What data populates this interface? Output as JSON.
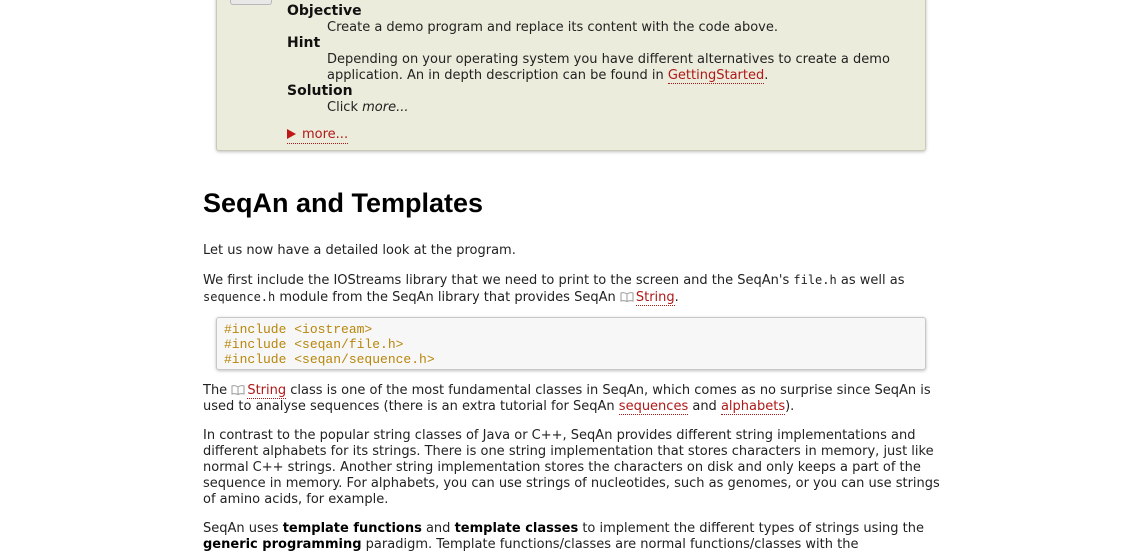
{
  "assignment": {
    "items": [
      {
        "term": "Objective",
        "desc": "Create a demo program and replace its content with the code above."
      },
      {
        "term": "Hint",
        "desc_before": "Depending on your operating system you have different alternatives to create a demo application. An in depth description can be found in ",
        "link": "GettingStarted",
        "desc_after": "."
      },
      {
        "term": "Solution",
        "desc_before": "Click ",
        "desc_em": "more..."
      }
    ],
    "more_label": "more..."
  },
  "section": {
    "heading": "SeqAn and Templates",
    "p1": "Let us now have a detailed look at the program.",
    "p2": {
      "t1": "We first include the IOStreams library that we need to print to the screen and the SeqAn's ",
      "c1": "file.h",
      "t2": " as well as ",
      "c2": "sequence.h",
      "t3": " module from the SeqAn library that provides SeqAn ",
      "link": "String",
      "t4": "."
    },
    "code_lines": [
      "#include <iostream>",
      "#include <seqan/file.h>",
      "#include <seqan/sequence.h>"
    ],
    "p3": {
      "t1": "The ",
      "link1": "String",
      "t2": " class is one of the most fundamental classes in SeqAn, which comes as no surprise since SeqAn is used to analyse sequences (there is an extra tutorial for SeqAn ",
      "link2": "sequences",
      "t3": " and ",
      "link3": "alphabets",
      "t4": ")."
    },
    "p4": "In contrast to the popular string classes of Java or C++, SeqAn provides different string implementations and different alphabets for its strings. There is one string implementation that stores characters in memory, just like normal C++ strings. Another string implementation stores the characters on disk and only keeps a part of the sequence in memory. For alphabets, you can use strings of nucleotides, such as genomes, or you can use strings of amino acids, for example.",
    "p5": {
      "t1": "SeqAn uses ",
      "b1": "template functions",
      "t2": " and ",
      "b2": "template classes",
      "t3": " to implement the different types of strings using the ",
      "b3": "generic programming",
      "t4": " paradigm. Template functions/classes are normal functions/classes with the"
    }
  },
  "colors": {
    "link": "#b01818",
    "assignment_bg": "#ececdc",
    "code_text": "#b8860b"
  },
  "icons": {
    "doc_link": "book-icon",
    "more": "triangle-right-icon"
  }
}
